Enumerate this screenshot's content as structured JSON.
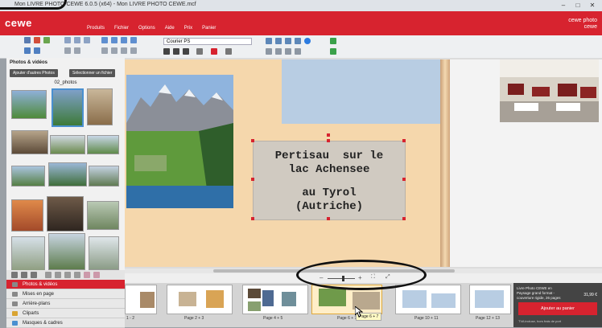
{
  "window": {
    "title": "Mon LIVRE PHOTO CEWE 6.0.5 (x64) - Mon LIVRE PHOTO CEWE.mcf",
    "minimize": "–",
    "maximize": "□",
    "close": "✕"
  },
  "brand": {
    "logo": "cewe",
    "right_logo": "cewe photo cewe",
    "accent": "#d7232f"
  },
  "menu": [
    "Produits",
    "Fichier",
    "Options",
    "Aide",
    "Prix",
    "Panier"
  ],
  "toolbar": {
    "font_value": "Courier PS"
  },
  "left_panel": {
    "title": "Photos & vidéos",
    "add_button": "Ajouter d'autres Photos",
    "select_button": "Sélectionner un fichier",
    "folder": "02_photos"
  },
  "accordion": [
    {
      "label": "Photos & vidéos",
      "active": true
    },
    {
      "label": "Mises en page",
      "active": false
    },
    {
      "label": "Arrière-plans",
      "active": false
    },
    {
      "label": "Cliparts",
      "active": false
    },
    {
      "label": "Masques & cadres",
      "active": false
    }
  ],
  "textbox": {
    "line1": "Pertisau  sur le",
    "line2": "lac Achensee",
    "line3": "au Tyrol",
    "line4": "(Autriche)"
  },
  "pages": [
    {
      "label": "1 - 2",
      "selected": false
    },
    {
      "label": "Page 2 + 3",
      "selected": false
    },
    {
      "label": "Page 4 + 5",
      "selected": false
    },
    {
      "label": "Page 6 + 7",
      "selected": true
    },
    {
      "label": "Page 10 + 11",
      "selected": false
    },
    {
      "label": "Page 12 + 13",
      "selected": false
    }
  ],
  "order": {
    "info": "Livre Photo CEWE en Paysage grand format - couverture rigide, 26 pages",
    "price": "31,99 €",
    "button": "Ajouter au panier",
    "note": "TVA incluse, hors frais de port"
  },
  "tooltip": "Page 6 + 7"
}
